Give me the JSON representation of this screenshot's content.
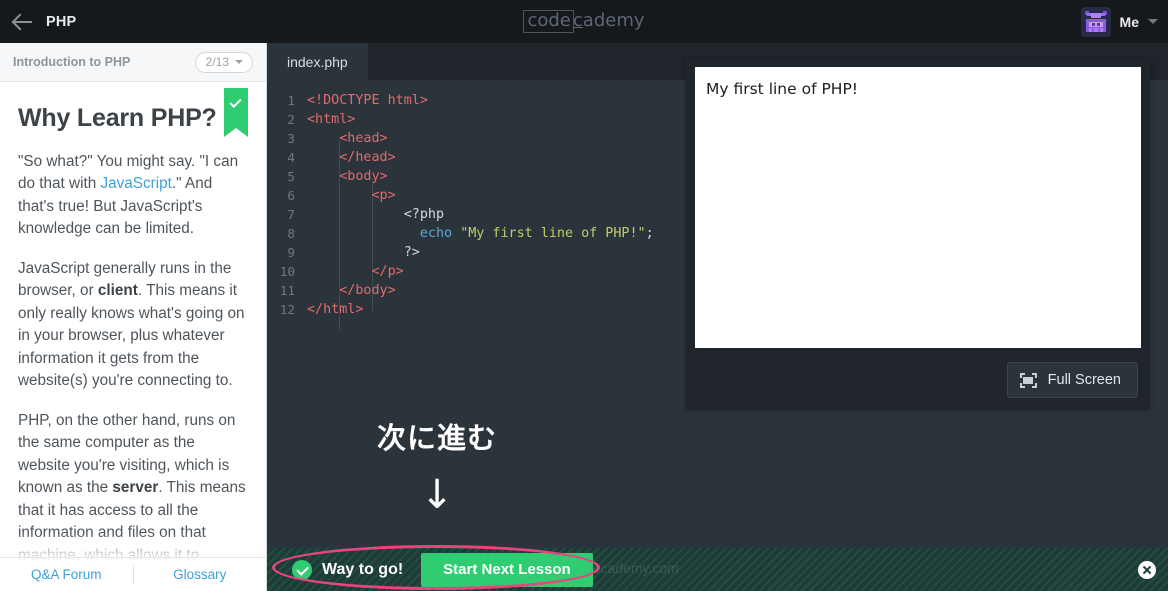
{
  "header": {
    "back_icon": "back-arrow-icon",
    "course_title": "PHP",
    "logo": {
      "boxed": "code",
      "rest": "c",
      "rest_tail": "ademy"
    },
    "account": {
      "label": "Me",
      "avatar_icon": "pixel-robot-avatar",
      "caret_icon": "chevron-down-icon"
    }
  },
  "sidebar": {
    "lesson_name": "Introduction to PHP",
    "progress": "2/13",
    "progress_caret_icon": "chevron-down-icon",
    "bookmark_icon": "bookmark-check-icon",
    "heading": "Why Learn PHP?",
    "paragraphs": [
      {
        "pre": "\"So what?\" You might say. \"I can do that with ",
        "link": "JavaScript",
        "post": ".\" And that's true! But JavaScript's knowledge can be limited."
      },
      {
        "pre": "JavaScript generally runs in the browser, or ",
        "bold": "client",
        "post": ". This means it only really knows what's going on in your browser, plus whatever information it gets from the website(s) you're connecting to."
      },
      {
        "pre": "PHP, on the other hand, runs on the same computer as the website you're visiting, which is known as the ",
        "bold": "server",
        "post": ". This means that it has access to all the information and files on that machine, which allows it to"
      }
    ],
    "footer": {
      "qa_forum": "Q&A Forum",
      "glossary": "Glossary"
    }
  },
  "editor": {
    "tab_label": "index.php",
    "lines": [
      {
        "n": "1",
        "tokens": [
          {
            "t": "tag",
            "v": "<!DOCTYPE html>"
          }
        ],
        "indent": 0
      },
      {
        "n": "2",
        "tokens": [
          {
            "t": "tag",
            "v": "<html>"
          }
        ],
        "indent": 0
      },
      {
        "n": "3",
        "tokens": [
          {
            "t": "tag",
            "v": "    <head>"
          }
        ],
        "indent": 0
      },
      {
        "n": "4",
        "tokens": [
          {
            "t": "tag",
            "v": "    </head>"
          }
        ],
        "indent": 0
      },
      {
        "n": "5",
        "tokens": [
          {
            "t": "tag",
            "v": "    <body>"
          }
        ],
        "indent": 0
      },
      {
        "n": "6",
        "tokens": [
          {
            "t": "tag",
            "v": "        <p>"
          }
        ],
        "indent": 0
      },
      {
        "n": "7",
        "tokens": [
          {
            "t": "plain",
            "v": "            <?php"
          }
        ],
        "indent": 0
      },
      {
        "n": "8",
        "tokens": [
          {
            "t": "plain",
            "v": "              "
          },
          {
            "t": "kw",
            "v": "echo"
          },
          {
            "t": "plain",
            "v": " "
          },
          {
            "t": "str",
            "v": "\"My first line of PHP!\""
          },
          {
            "t": "punct",
            "v": ";"
          }
        ],
        "indent": 0
      },
      {
        "n": "9",
        "tokens": [
          {
            "t": "plain",
            "v": "            ?>"
          }
        ],
        "indent": 0
      },
      {
        "n": "10",
        "tokens": [
          {
            "t": "tag",
            "v": "        </p>"
          }
        ],
        "indent": 0
      },
      {
        "n": "11",
        "tokens": [
          {
            "t": "tag",
            "v": "    </body>"
          }
        ],
        "indent": 0
      },
      {
        "n": "12",
        "tokens": [
          {
            "t": "tag",
            "v": "</html>"
          }
        ],
        "indent": 0
      }
    ]
  },
  "annotation": {
    "japanese_text": "次に進む",
    "arrow_glyph": "↓",
    "ellipse_color": "#e8447f"
  },
  "preview": {
    "output_text": "My first line of PHP!",
    "fullscreen_label": "Full Screen",
    "fullscreen_icon": "fullscreen-icon"
  },
  "bottom_bar": {
    "check_icon": "success-check-icon",
    "success_text": "Way to go!",
    "watermark_text": "Codecademy.com",
    "next_button_label": "Start Next Lesson",
    "close_icon": "close-icon",
    "stripe_color": "#1f3b36",
    "accent_color": "#2fcc71"
  }
}
